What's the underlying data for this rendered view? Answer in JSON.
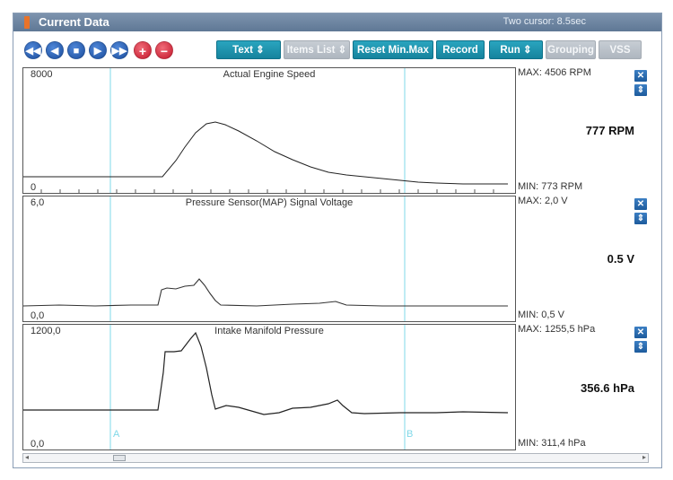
{
  "window": {
    "title": "Current Data",
    "cursor_info": "Two cursor: 8.5sec"
  },
  "toolbar": {
    "nav_buttons": [
      {
        "name": "rewind",
        "glyph": "◀◀"
      },
      {
        "name": "step-back",
        "glyph": "◀"
      },
      {
        "name": "stop",
        "glyph": "■"
      },
      {
        "name": "play",
        "glyph": "▶"
      },
      {
        "name": "fast-forward",
        "glyph": "▶▶"
      },
      {
        "name": "add",
        "glyph": "+"
      },
      {
        "name": "remove",
        "glyph": "−"
      }
    ],
    "text_label": "Text",
    "items_list_label": "Items List",
    "reset_label": "Reset Min.Max",
    "record_label": "Record",
    "run_label": "Run",
    "grouping_label": "Grouping",
    "vss_label": "VSS",
    "spin_glyph": "⇕"
  },
  "cursors": {
    "a_label": "A",
    "b_label": "B"
  },
  "panels": [
    {
      "title": "Actual Engine Speed",
      "top_label": "8000",
      "bottom_label": "0",
      "max_text": "MAX:  4506 RPM",
      "min_text": "MIN:   773 RPM",
      "current": "777 RPM"
    },
    {
      "title": "Pressure Sensor(MAP) Signal Voltage",
      "top_label": "6,0",
      "bottom_label": "0,0",
      "max_text": "MAX:   2,0 V",
      "min_text": "MIN:   0,5 V",
      "current": "0.5 V"
    },
    {
      "title": "Intake Manifold Pressure",
      "top_label": "1200,0",
      "bottom_label": "0,0",
      "max_text": "MAX: 1255,5 hPa",
      "min_text": "MIN: 311,4 hPa",
      "current": "356.6 hPa"
    }
  ],
  "side_buttons": {
    "close_glyph": "✕",
    "resize_glyph": "⇕"
  },
  "scrollbar": {
    "left_glyph": "◂",
    "right_glyph": "▸"
  },
  "colors": {
    "title_bar": "#6a819d",
    "button_teal": "#1f95b0",
    "cursor_line": "#7fd8e8"
  }
}
